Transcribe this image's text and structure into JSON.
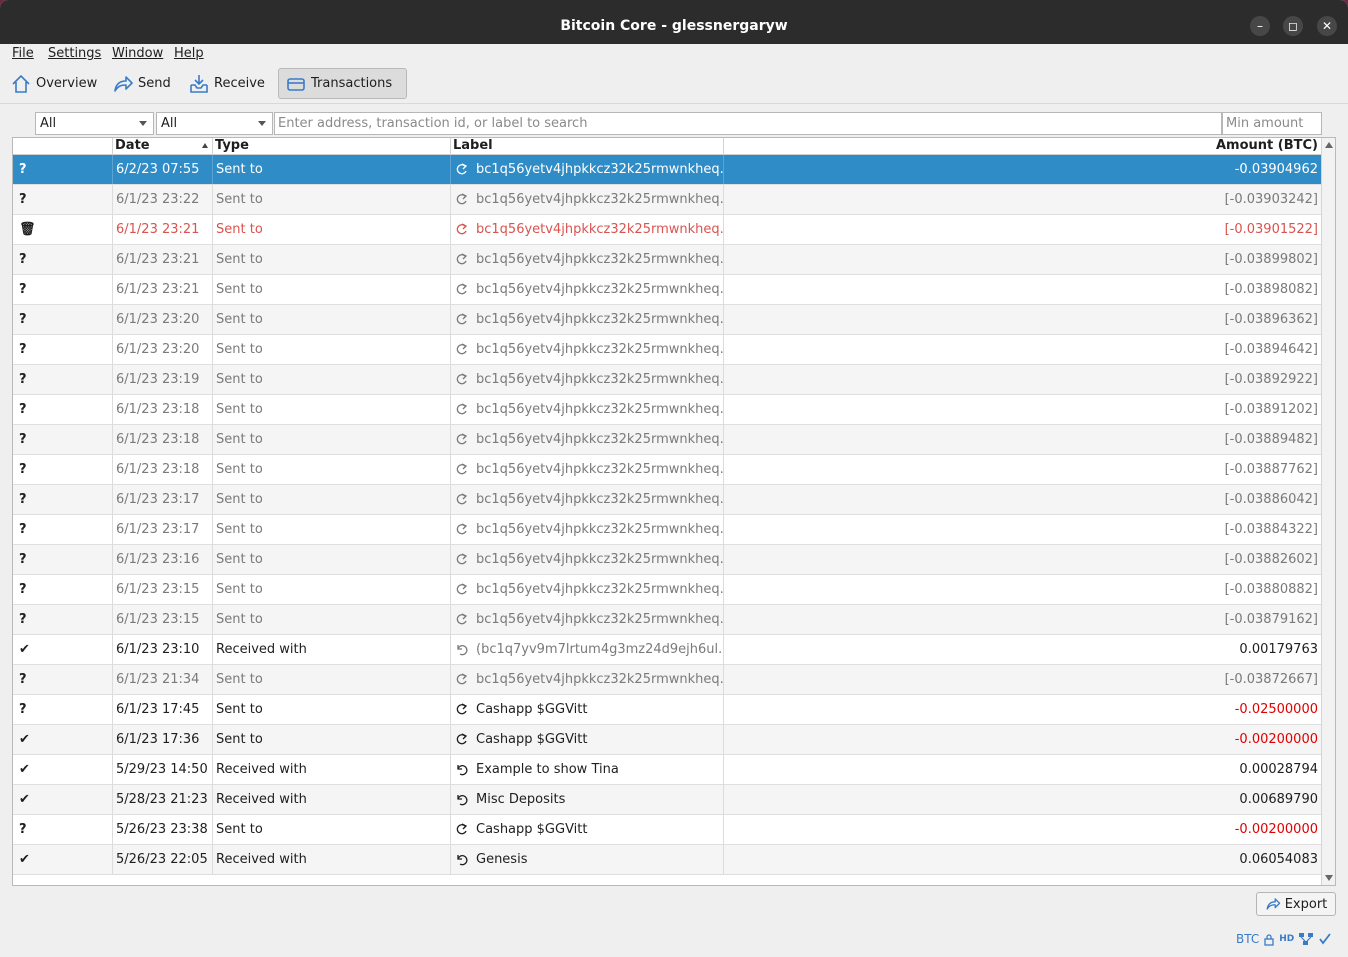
{
  "window": {
    "title": "Bitcoin Core - glessnergaryw",
    "controls": {
      "minimize": "–",
      "maximize": "◻",
      "close": "✕"
    }
  },
  "menu": {
    "file": "File",
    "settings": "Settings",
    "window": "Window",
    "help": "Help"
  },
  "toolbar": {
    "overview": "Overview",
    "send": "Send",
    "receive": "Receive",
    "transactions": "Transactions",
    "active": "transactions"
  },
  "filters": {
    "date_filter": "All",
    "type_filter": "All",
    "search_placeholder": "Enter address, transaction id, or label to search",
    "amount_placeholder": "Min amount"
  },
  "table": {
    "columns": {
      "date": "Date",
      "type": "Type",
      "label": "Label",
      "amount": "Amount (BTC)"
    },
    "sort_column": "date",
    "rows": [
      {
        "status": "?",
        "status_icon": "unconfirmed-icon",
        "date": "6/2/23 07:55",
        "type": "Sent to",
        "label": "bc1q56yetv4jhpkkcz32k25rmwnkheq...",
        "amount": "-0.03904962",
        "style": "selected",
        "direction": "out"
      },
      {
        "status": "?",
        "status_icon": "unconfirmed-icon",
        "date": "6/1/23 23:22",
        "type": "Sent to",
        "label": "bc1q56yetv4jhpkkcz32k25rmwnkheq...",
        "amount": "[-0.03903242]",
        "style": "muted",
        "direction": "out"
      },
      {
        "status": "🗑",
        "status_icon": "abandoned-trash-icon",
        "date": "6/1/23 23:21",
        "type": "Sent to",
        "label": "bc1q56yetv4jhpkkcz32k25rmwnkheq...",
        "amount": "[-0.03901522]",
        "style": "abandoned",
        "direction": "out"
      },
      {
        "status": "?",
        "status_icon": "unconfirmed-icon",
        "date": "6/1/23 23:21",
        "type": "Sent to",
        "label": "bc1q56yetv4jhpkkcz32k25rmwnkheq...",
        "amount": "[-0.03899802]",
        "style": "muted",
        "direction": "out"
      },
      {
        "status": "?",
        "status_icon": "unconfirmed-icon",
        "date": "6/1/23 23:21",
        "type": "Sent to",
        "label": "bc1q56yetv4jhpkkcz32k25rmwnkheq...",
        "amount": "[-0.03898082]",
        "style": "muted",
        "direction": "out"
      },
      {
        "status": "?",
        "status_icon": "unconfirmed-icon",
        "date": "6/1/23 23:20",
        "type": "Sent to",
        "label": "bc1q56yetv4jhpkkcz32k25rmwnkheq...",
        "amount": "[-0.03896362]",
        "style": "muted",
        "direction": "out"
      },
      {
        "status": "?",
        "status_icon": "unconfirmed-icon",
        "date": "6/1/23 23:20",
        "type": "Sent to",
        "label": "bc1q56yetv4jhpkkcz32k25rmwnkheq...",
        "amount": "[-0.03894642]",
        "style": "muted",
        "direction": "out"
      },
      {
        "status": "?",
        "status_icon": "unconfirmed-icon",
        "date": "6/1/23 23:19",
        "type": "Sent to",
        "label": "bc1q56yetv4jhpkkcz32k25rmwnkheq...",
        "amount": "[-0.03892922]",
        "style": "muted",
        "direction": "out"
      },
      {
        "status": "?",
        "status_icon": "unconfirmed-icon",
        "date": "6/1/23 23:18",
        "type": "Sent to",
        "label": "bc1q56yetv4jhpkkcz32k25rmwnkheq...",
        "amount": "[-0.03891202]",
        "style": "muted",
        "direction": "out"
      },
      {
        "status": "?",
        "status_icon": "unconfirmed-icon",
        "date": "6/1/23 23:18",
        "type": "Sent to",
        "label": "bc1q56yetv4jhpkkcz32k25rmwnkheq...",
        "amount": "[-0.03889482]",
        "style": "muted",
        "direction": "out"
      },
      {
        "status": "?",
        "status_icon": "unconfirmed-icon",
        "date": "6/1/23 23:18",
        "type": "Sent to",
        "label": "bc1q56yetv4jhpkkcz32k25rmwnkheq...",
        "amount": "[-0.03887762]",
        "style": "muted",
        "direction": "out"
      },
      {
        "status": "?",
        "status_icon": "unconfirmed-icon",
        "date": "6/1/23 23:17",
        "type": "Sent to",
        "label": "bc1q56yetv4jhpkkcz32k25rmwnkheq...",
        "amount": "[-0.03886042]",
        "style": "muted",
        "direction": "out"
      },
      {
        "status": "?",
        "status_icon": "unconfirmed-icon",
        "date": "6/1/23 23:17",
        "type": "Sent to",
        "label": "bc1q56yetv4jhpkkcz32k25rmwnkheq...",
        "amount": "[-0.03884322]",
        "style": "muted",
        "direction": "out"
      },
      {
        "status": "?",
        "status_icon": "unconfirmed-icon",
        "date": "6/1/23 23:16",
        "type": "Sent to",
        "label": "bc1q56yetv4jhpkkcz32k25rmwnkheq...",
        "amount": "[-0.03882602]",
        "style": "muted",
        "direction": "out"
      },
      {
        "status": "?",
        "status_icon": "unconfirmed-icon",
        "date": "6/1/23 23:15",
        "type": "Sent to",
        "label": "bc1q56yetv4jhpkkcz32k25rmwnkheq...",
        "amount": "[-0.03880882]",
        "style": "muted",
        "direction": "out"
      },
      {
        "status": "?",
        "status_icon": "unconfirmed-icon",
        "date": "6/1/23 23:15",
        "type": "Sent to",
        "label": "bc1q56yetv4jhpkkcz32k25rmwnkheq...",
        "amount": "[-0.03879162]",
        "style": "muted",
        "direction": "out"
      },
      {
        "status": "✔",
        "status_icon": "confirmed-check-icon",
        "date": "6/1/23 23:10",
        "type": "Received with",
        "label": "(bc1q7yv9m7lrtum4g3mz24d9ejh6ul...",
        "amount": "0.00179763",
        "style": "normal",
        "label_muted": true,
        "direction": "in"
      },
      {
        "status": "?",
        "status_icon": "unconfirmed-icon",
        "date": "6/1/23 21:34",
        "type": "Sent to",
        "label": "bc1q56yetv4jhpkkcz32k25rmwnkheq...",
        "amount": "[-0.03872667]",
        "style": "muted",
        "direction": "out"
      },
      {
        "status": "?",
        "status_icon": "unconfirmed-icon",
        "date": "6/1/23 17:45",
        "type": "Sent to",
        "label": "Cashapp $GGVitt",
        "amount": "-0.02500000",
        "style": "normal",
        "negative": true,
        "direction": "out"
      },
      {
        "status": "✔",
        "status_icon": "confirmed-check-icon",
        "date": "6/1/23 17:36",
        "type": "Sent to",
        "label": "Cashapp $GGVitt",
        "amount": "-0.00200000",
        "style": "normal",
        "negative": true,
        "direction": "out"
      },
      {
        "status": "✔",
        "status_icon": "confirmed-check-icon",
        "date": "5/29/23 14:50",
        "type": "Received with",
        "label": "Example to show Tina",
        "amount": "0.00028794",
        "style": "normal",
        "direction": "in"
      },
      {
        "status": "✔",
        "status_icon": "confirmed-check-icon",
        "date": "5/28/23 21:23",
        "type": "Received with",
        "label": "Misc Deposits",
        "amount": "0.00689790",
        "style": "normal",
        "direction": "in"
      },
      {
        "status": "?",
        "status_icon": "unconfirmed-icon",
        "date": "5/26/23 23:38",
        "type": "Sent to",
        "label": "Cashapp $GGVitt",
        "amount": "-0.00200000",
        "style": "normal",
        "negative": true,
        "direction": "out"
      },
      {
        "status": "✔",
        "status_icon": "confirmed-check-icon",
        "date": "5/26/23 22:05",
        "type": "Received with",
        "label": "Genesis",
        "amount": "0.06054083",
        "style": "normal",
        "direction": "in"
      }
    ]
  },
  "export": {
    "label": "Export"
  },
  "statusbar": {
    "unit": "BTC",
    "hd": "HD"
  },
  "colors": {
    "selection": "#308cc6",
    "negative": "#e00000",
    "abandoned": "#d9534f",
    "muted": "#7a7a7a",
    "status_icons": "#3a7bc8"
  }
}
